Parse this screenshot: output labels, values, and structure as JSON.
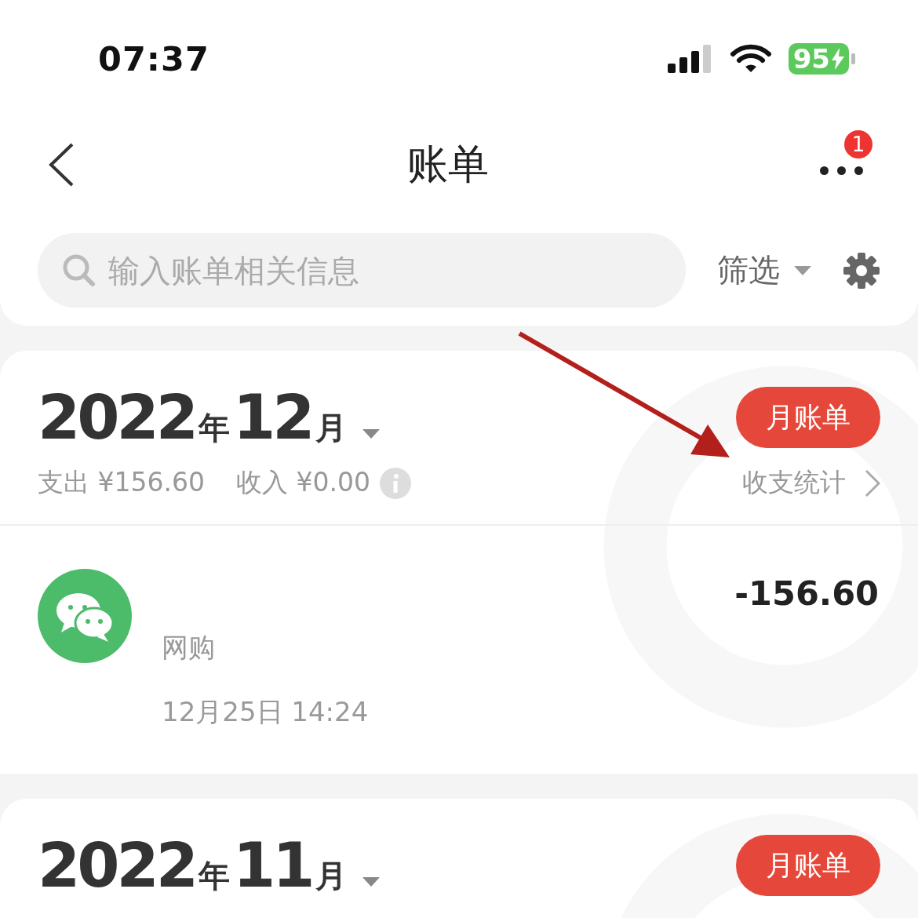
{
  "status_bar": {
    "time": "07:37",
    "battery": "95"
  },
  "nav": {
    "title": "账单",
    "badge": "1"
  },
  "search": {
    "placeholder": "输入账单相关信息",
    "filter": "筛选"
  },
  "months": [
    {
      "year": "2022",
      "year_unit": "年",
      "month": "12",
      "month_unit": "月",
      "button": "月账单",
      "expense_label": "支出",
      "expense": "¥156.60",
      "income_label": "收入",
      "income": "¥0.00",
      "stats_link": "收支统计",
      "transactions": [
        {
          "category": "网购",
          "time": "12月25日 14:24",
          "amount": "-156.60"
        }
      ]
    },
    {
      "year": "2022",
      "year_unit": "年",
      "month": "11",
      "month_unit": "月",
      "button": "月账单"
    }
  ]
}
